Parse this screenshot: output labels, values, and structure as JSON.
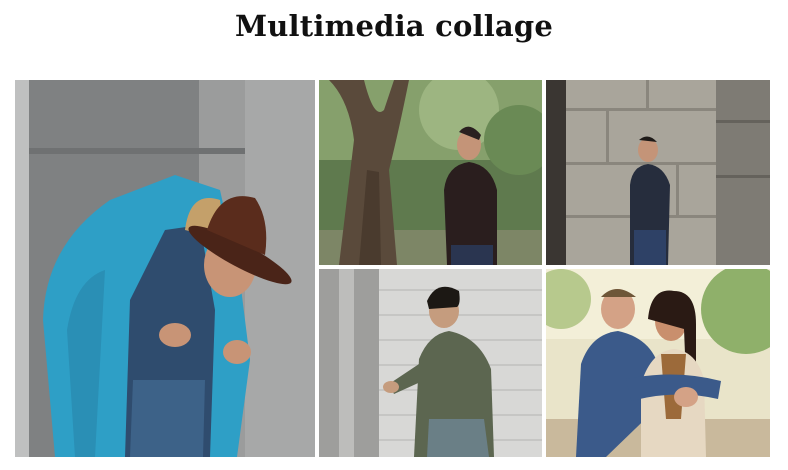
{
  "page": {
    "title": "Multimedia collage"
  },
  "collage": {
    "photos": [
      {
        "subject": "man-in-teal-blazer-and-brown-hat"
      },
      {
        "subject": "man-in-black-turtleneck-by-tree"
      },
      {
        "subject": "man-by-stone-columns"
      },
      {
        "subject": "man-leaning-on-white-brick-wall"
      },
      {
        "subject": "couple-embracing-outdoors"
      }
    ]
  },
  "colors": {
    "background": "#ffffff",
    "title_text": "#111111"
  }
}
